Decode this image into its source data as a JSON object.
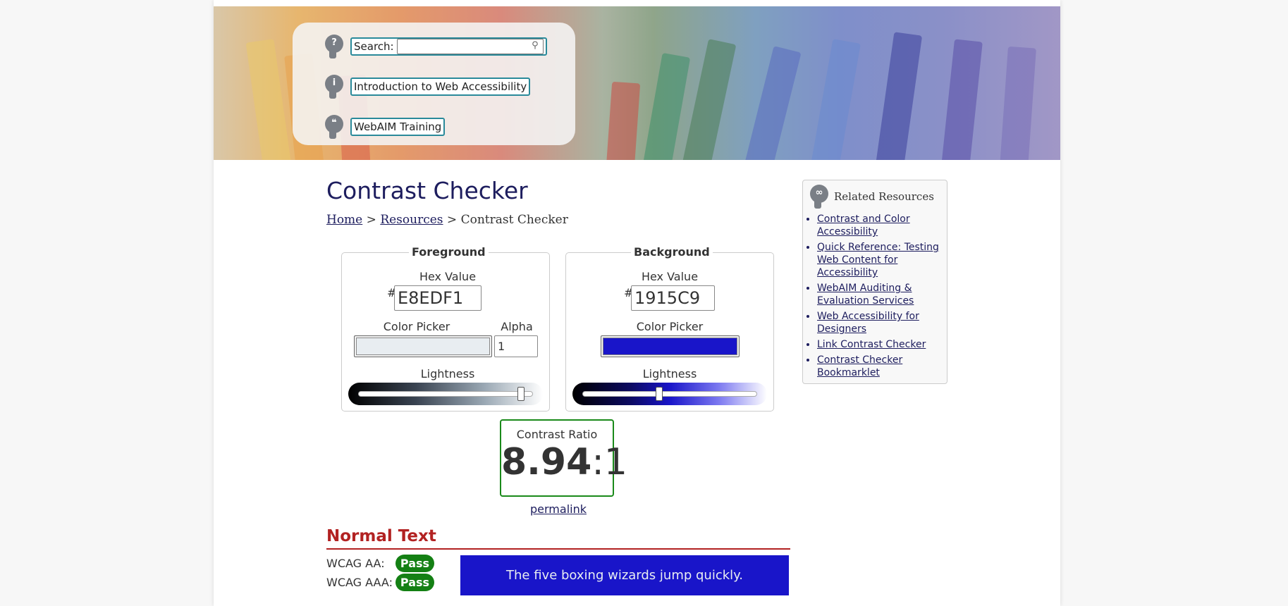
{
  "nav": {
    "search_label": "Search:",
    "search_value": "",
    "link_intro": "Introduction to Web Accessibility",
    "link_training": "WebAIM Training"
  },
  "main": {
    "title": "Contrast Checker",
    "breadcrumb": {
      "home": "Home",
      "sep1": ">",
      "resources": "Resources",
      "sep2": ">",
      "current": "Contrast Checker"
    }
  },
  "foreground": {
    "legend": "Foreground",
    "hex_label": "Hex Value",
    "hash": "#",
    "hex_value": "E8EDF1",
    "picker_label": "Color Picker",
    "alpha_label": "Alpha",
    "alpha_value": "1",
    "lightness_label": "Lightness",
    "lightness": 0.93,
    "color": "#e8edf1"
  },
  "background": {
    "legend": "Background",
    "hex_label": "Hex Value",
    "hash": "#",
    "hex_value": "1915C9",
    "picker_label": "Color Picker",
    "lightness_label": "Lightness",
    "lightness": 0.44,
    "color": "#1915c9"
  },
  "ratio": {
    "label": "Contrast Ratio",
    "value": "8.94",
    "sep": ":",
    "suffix": "1",
    "permalink": "permalink",
    "border_color": "#1a8a1a"
  },
  "normal_text": {
    "heading": "Normal Text",
    "aa_label": "WCAG AA:",
    "aa_result": "Pass",
    "aaa_label": "WCAG AAA:",
    "aaa_result": "Pass",
    "sample": "The five boxing wizards jump quickly.",
    "pass_color": "#148014"
  },
  "related": {
    "title": "Related Resources",
    "links": [
      "Contrast and Color Accessibility",
      "Quick Reference: Testing Web Content for Accessibility",
      "WebAIM Auditing & Evaluation Services",
      "Web Accessibility for Designers",
      "Link Contrast Checker",
      "Contrast Checker Bookmarklet"
    ]
  }
}
